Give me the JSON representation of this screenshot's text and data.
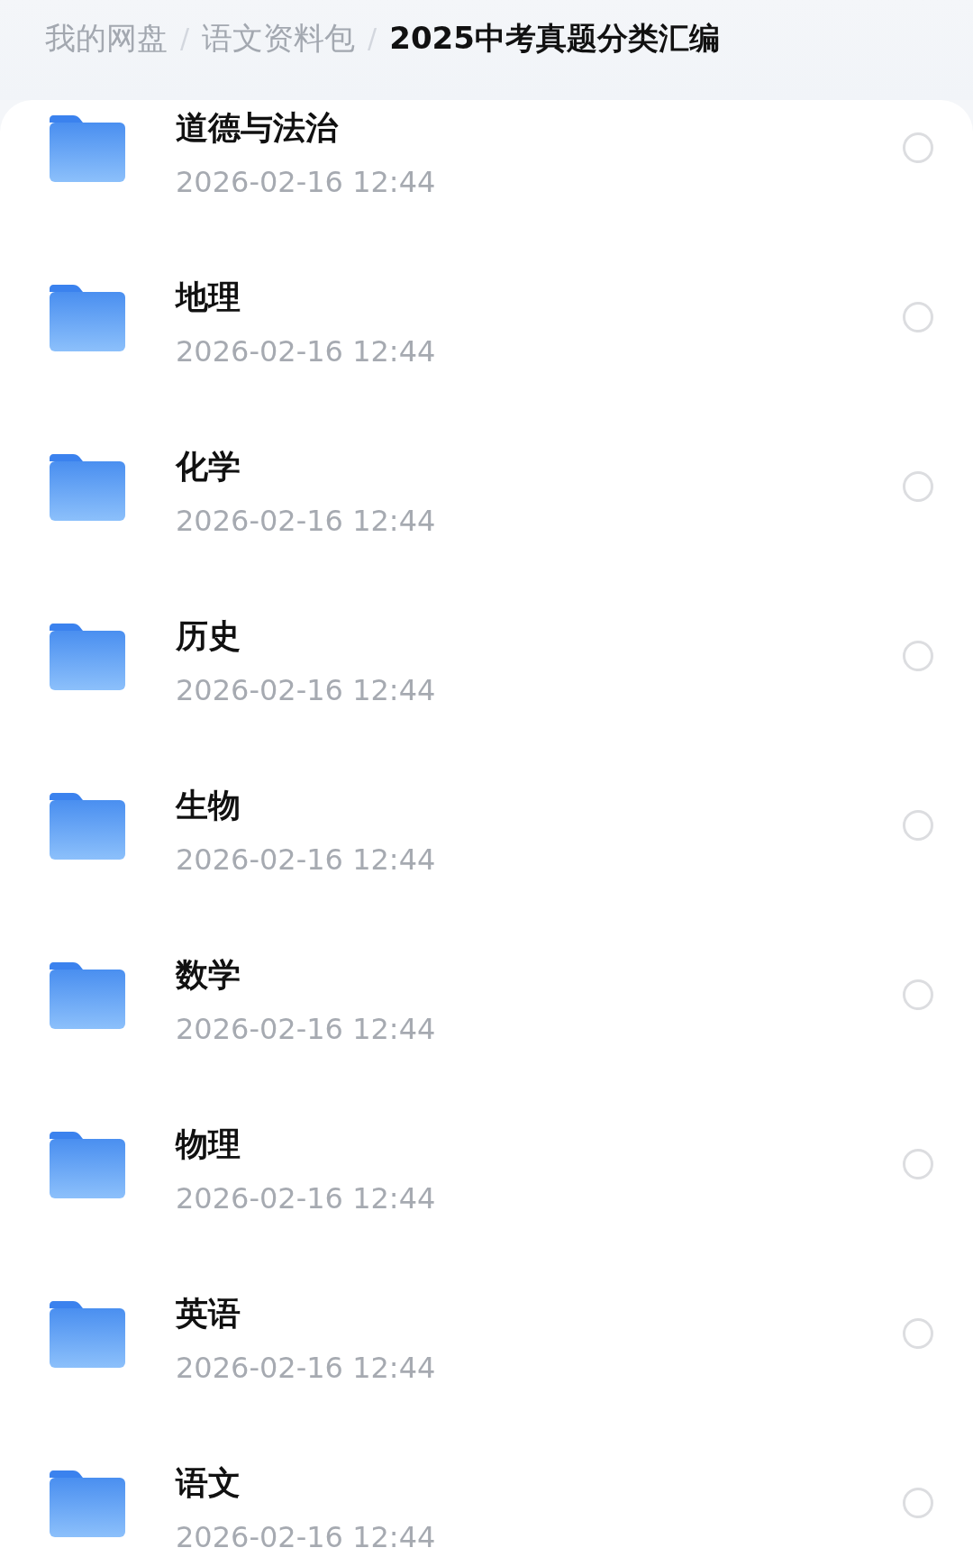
{
  "breadcrumb": [
    {
      "label": "我的网盘",
      "current": false
    },
    {
      "label": "语文资料包",
      "current": false
    },
    {
      "label": "2025中考真题分类汇编",
      "current": true
    }
  ],
  "separator": "/",
  "folders": [
    {
      "name": "道德与法治",
      "modified": "2026-02-16 12:44",
      "selected": false
    },
    {
      "name": "地理",
      "modified": "2026-02-16 12:44",
      "selected": false
    },
    {
      "name": "化学",
      "modified": "2026-02-16 12:44",
      "selected": false
    },
    {
      "name": "历史",
      "modified": "2026-02-16 12:44",
      "selected": false
    },
    {
      "name": "生物",
      "modified": "2026-02-16 12:44",
      "selected": false
    },
    {
      "name": "数学",
      "modified": "2026-02-16 12:44",
      "selected": false
    },
    {
      "name": "物理",
      "modified": "2026-02-16 12:44",
      "selected": false
    },
    {
      "name": "英语",
      "modified": "2026-02-16 12:44",
      "selected": false
    },
    {
      "name": "语文",
      "modified": "2026-02-16 12:44",
      "selected": false
    }
  ]
}
